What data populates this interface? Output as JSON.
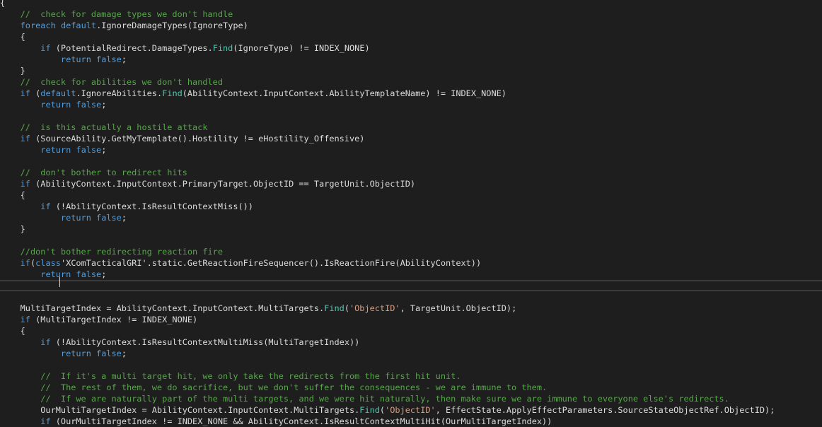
{
  "code_lines": [
    {
      "text": "{",
      "tokens": [
        {
          "t": "{",
          "c": "plain"
        }
      ]
    },
    {
      "text": "    //  check for damage types we don't handle",
      "tokens": [
        {
          "t": "    ",
          "c": "plain"
        },
        {
          "t": "//  check for damage types we don't handle",
          "c": "comment"
        }
      ]
    },
    {
      "text": "    foreach default.IgnoreDamageTypes(IgnoreType)",
      "tokens": [
        {
          "t": "    ",
          "c": "plain"
        },
        {
          "t": "foreach",
          "c": "keyword"
        },
        {
          "t": " ",
          "c": "plain"
        },
        {
          "t": "default",
          "c": "keyword"
        },
        {
          "t": ".IgnoreDamageTypes(IgnoreType)",
          "c": "plain"
        }
      ]
    },
    {
      "text": "    {",
      "tokens": [
        {
          "t": "    {",
          "c": "plain"
        }
      ]
    },
    {
      "text": "        if (PotentialRedirect.DamageTypes.Find(IgnoreType) != INDEX_NONE)",
      "tokens": [
        {
          "t": "        ",
          "c": "plain"
        },
        {
          "t": "if",
          "c": "keyword"
        },
        {
          "t": " (PotentialRedirect.DamageTypes.",
          "c": "plain"
        },
        {
          "t": "Find",
          "c": "method"
        },
        {
          "t": "(IgnoreType) != INDEX_NONE)",
          "c": "plain"
        }
      ]
    },
    {
      "text": "            return false;",
      "tokens": [
        {
          "t": "            ",
          "c": "plain"
        },
        {
          "t": "return",
          "c": "keyword"
        },
        {
          "t": " ",
          "c": "plain"
        },
        {
          "t": "false",
          "c": "keyword"
        },
        {
          "t": ";",
          "c": "plain"
        }
      ]
    },
    {
      "text": "    }",
      "tokens": [
        {
          "t": "    }",
          "c": "plain"
        }
      ]
    },
    {
      "text": "    //  check for abilities we don't handled",
      "tokens": [
        {
          "t": "    ",
          "c": "plain"
        },
        {
          "t": "//  check for abilities we don't handled",
          "c": "comment"
        }
      ]
    },
    {
      "text": "    if (default.IgnoreAbilities.Find(AbilityContext.InputContext.AbilityTemplateName) != INDEX_NONE)",
      "tokens": [
        {
          "t": "    ",
          "c": "plain"
        },
        {
          "t": "if",
          "c": "keyword"
        },
        {
          "t": " (",
          "c": "plain"
        },
        {
          "t": "default",
          "c": "keyword"
        },
        {
          "t": ".IgnoreAbilities.",
          "c": "plain"
        },
        {
          "t": "Find",
          "c": "method"
        },
        {
          "t": "(AbilityContext.InputContext.AbilityTemplateName) != INDEX_NONE)",
          "c": "plain"
        }
      ]
    },
    {
      "text": "        return false;",
      "tokens": [
        {
          "t": "        ",
          "c": "plain"
        },
        {
          "t": "return",
          "c": "keyword"
        },
        {
          "t": " ",
          "c": "plain"
        },
        {
          "t": "false",
          "c": "keyword"
        },
        {
          "t": ";",
          "c": "plain"
        }
      ]
    },
    {
      "text": "",
      "tokens": []
    },
    {
      "text": "    //  is this actually a hostile attack",
      "tokens": [
        {
          "t": "    ",
          "c": "plain"
        },
        {
          "t": "//  is this actually a hostile attack",
          "c": "comment"
        }
      ]
    },
    {
      "text": "    if (SourceAbility.GetMyTemplate().Hostility != eHostility_Offensive)",
      "tokens": [
        {
          "t": "    ",
          "c": "plain"
        },
        {
          "t": "if",
          "c": "keyword"
        },
        {
          "t": " (SourceAbility.GetMyTemplate().Hostility != eHostility_Offensive)",
          "c": "plain"
        }
      ]
    },
    {
      "text": "        return false;",
      "tokens": [
        {
          "t": "        ",
          "c": "plain"
        },
        {
          "t": "return",
          "c": "keyword"
        },
        {
          "t": " ",
          "c": "plain"
        },
        {
          "t": "false",
          "c": "keyword"
        },
        {
          "t": ";",
          "c": "plain"
        }
      ]
    },
    {
      "text": "",
      "tokens": []
    },
    {
      "text": "    //  don't bother to redirect hits",
      "tokens": [
        {
          "t": "    ",
          "c": "plain"
        },
        {
          "t": "//  don't bother to redirect hits",
          "c": "comment"
        }
      ]
    },
    {
      "text": "    if (AbilityContext.InputContext.PrimaryTarget.ObjectID == TargetUnit.ObjectID)",
      "tokens": [
        {
          "t": "    ",
          "c": "plain"
        },
        {
          "t": "if",
          "c": "keyword"
        },
        {
          "t": " (AbilityContext.InputContext.PrimaryTarget.ObjectID == TargetUnit.ObjectID)",
          "c": "plain"
        }
      ]
    },
    {
      "text": "    {",
      "tokens": [
        {
          "t": "    {",
          "c": "plain"
        }
      ]
    },
    {
      "text": "        if (!AbilityContext.IsResultContextMiss())",
      "tokens": [
        {
          "t": "        ",
          "c": "plain"
        },
        {
          "t": "if",
          "c": "keyword"
        },
        {
          "t": " (!AbilityContext.IsResultContextMiss())",
          "c": "plain"
        }
      ]
    },
    {
      "text": "            return false;",
      "tokens": [
        {
          "t": "            ",
          "c": "plain"
        },
        {
          "t": "return",
          "c": "keyword"
        },
        {
          "t": " ",
          "c": "plain"
        },
        {
          "t": "false",
          "c": "keyword"
        },
        {
          "t": ";",
          "c": "plain"
        }
      ]
    },
    {
      "text": "    }",
      "tokens": [
        {
          "t": "    }",
          "c": "plain"
        }
      ]
    },
    {
      "text": "",
      "tokens": []
    },
    {
      "text": "    //don't bother redirecting reaction fire",
      "tokens": [
        {
          "t": "    ",
          "c": "plain"
        },
        {
          "t": "//don't bother redirecting reaction fire",
          "c": "comment"
        }
      ]
    },
    {
      "text": "    if(class'XComTacticalGRI'.static.GetReactionFireSequencer().IsReactionFire(AbilityContext))",
      "tokens": [
        {
          "t": "    ",
          "c": "plain"
        },
        {
          "t": "if",
          "c": "keyword"
        },
        {
          "t": "(",
          "c": "plain"
        },
        {
          "t": "class",
          "c": "keyword"
        },
        {
          "t": "'XComTacticalGRI'",
          "c": "plain"
        },
        {
          "t": ".static.GetReactionFireSequencer().IsReactionFire(AbilityContext))",
          "c": "plain"
        }
      ]
    },
    {
      "text": "        return false;",
      "tokens": [
        {
          "t": "        ",
          "c": "plain"
        },
        {
          "t": "return",
          "c": "keyword"
        },
        {
          "t": " ",
          "c": "plain"
        },
        {
          "t": "false",
          "c": "keyword"
        },
        {
          "t": ";",
          "c": "plain"
        }
      ]
    },
    {
      "text": "",
      "tokens": [],
      "current": true
    },
    {
      "text": "",
      "tokens": []
    },
    {
      "text": "    MultiTargetIndex = AbilityContext.InputContext.MultiTargets.Find('ObjectID', TargetUnit.ObjectID);",
      "tokens": [
        {
          "t": "    MultiTargetIndex = AbilityContext.InputContext.MultiTargets.",
          "c": "plain"
        },
        {
          "t": "Find",
          "c": "method"
        },
        {
          "t": "(",
          "c": "plain"
        },
        {
          "t": "'ObjectID'",
          "c": "string"
        },
        {
          "t": ", TargetUnit.ObjectID);",
          "c": "plain"
        }
      ]
    },
    {
      "text": "    if (MultiTargetIndex != INDEX_NONE)",
      "tokens": [
        {
          "t": "    ",
          "c": "plain"
        },
        {
          "t": "if",
          "c": "keyword"
        },
        {
          "t": " (MultiTargetIndex != INDEX_NONE)",
          "c": "plain"
        }
      ]
    },
    {
      "text": "    {",
      "tokens": [
        {
          "t": "    {",
          "c": "plain"
        }
      ]
    },
    {
      "text": "        if (!AbilityContext.IsResultContextMultiMiss(MultiTargetIndex))",
      "tokens": [
        {
          "t": "        ",
          "c": "plain"
        },
        {
          "t": "if",
          "c": "keyword"
        },
        {
          "t": " (!AbilityContext.IsResultContextMultiMiss(MultiTargetIndex))",
          "c": "plain"
        }
      ]
    },
    {
      "text": "            return false;",
      "tokens": [
        {
          "t": "            ",
          "c": "plain"
        },
        {
          "t": "return",
          "c": "keyword"
        },
        {
          "t": " ",
          "c": "plain"
        },
        {
          "t": "false",
          "c": "keyword"
        },
        {
          "t": ";",
          "c": "plain"
        }
      ]
    },
    {
      "text": "",
      "tokens": []
    },
    {
      "text": "        //  If it's a multi target hit, we only take the redirects from the first hit unit.",
      "tokens": [
        {
          "t": "        ",
          "c": "plain"
        },
        {
          "t": "//  If it's a multi target hit, we only take the redirects from the first hit unit.",
          "c": "comment"
        }
      ]
    },
    {
      "text": "        //  The rest of them, we do sacrifice, but we don't suffer the consequences - we are immune to them.",
      "tokens": [
        {
          "t": "        ",
          "c": "plain"
        },
        {
          "t": "//  The rest of them, we do sacrifice, but we don't suffer the consequences - we are immune to them.",
          "c": "comment"
        }
      ]
    },
    {
      "text": "        //  If we are naturally part of the multi targets, and we were hit naturally, then make sure we are immune to everyone else's redirects.",
      "tokens": [
        {
          "t": "        ",
          "c": "plain"
        },
        {
          "t": "//  If we are naturally part of the multi targets, and we were hit naturally, then make sure we are immune to everyone else's redirects.",
          "c": "comment"
        }
      ]
    },
    {
      "text": "        OurMultiTargetIndex = AbilityContext.InputContext.MultiTargets.Find('ObjectID', EffectState.ApplyEffectParameters.SourceStateObjectRef.ObjectID);",
      "tokens": [
        {
          "t": "        OurMultiTargetIndex = AbilityContext.InputContext.MultiTargets.",
          "c": "plain"
        },
        {
          "t": "Find",
          "c": "method"
        },
        {
          "t": "(",
          "c": "plain"
        },
        {
          "t": "'ObjectID'",
          "c": "string"
        },
        {
          "t": ", EffectState.ApplyEffectParameters.SourceStateObjectRef.ObjectID);",
          "c": "plain"
        }
      ]
    },
    {
      "text": "        if (OurMultiTargetIndex != INDEX_NONE && AbilityContext.IsResultContextMultiHit(OurMultiTargetIndex))",
      "tokens": [
        {
          "t": "        ",
          "c": "plain"
        },
        {
          "t": "if",
          "c": "keyword"
        },
        {
          "t": " (OurMultiTargetIndex != INDEX_NONE && AbilityContext.IsResultContextMultiHit(OurMultiTargetIndex))",
          "c": "plain"
        }
      ]
    },
    {
      "text": "        {",
      "tokens": [
        {
          "t": "        {",
          "c": "plain"
        }
      ]
    }
  ]
}
